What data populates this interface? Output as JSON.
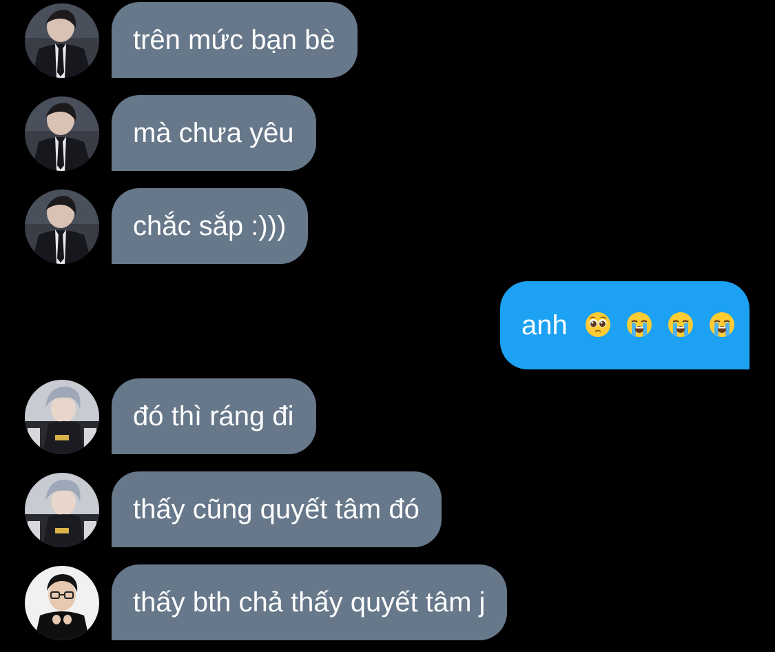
{
  "conversation": {
    "messages": [
      {
        "direction": "incoming",
        "sender_avatar": "avatar-suit-boy",
        "text": "trên mức bạn bè"
      },
      {
        "direction": "incoming",
        "sender_avatar": "avatar-suit-boy",
        "text": "mà chưa yêu"
      },
      {
        "direction": "incoming",
        "sender_avatar": "avatar-suit-boy",
        "text": "chắc sắp :)))"
      },
      {
        "direction": "outgoing",
        "text": "anh",
        "emojis": [
          "pleading-face-emoji",
          "loudly-crying-face-emoji",
          "loudly-crying-face-emoji",
          "loudly-crying-face-emoji"
        ]
      },
      {
        "direction": "incoming",
        "sender_avatar": "avatar-silver-hair",
        "text": "đó thì ráng đi"
      },
      {
        "direction": "incoming",
        "sender_avatar": "avatar-silver-hair",
        "text": "thấy cũng quyết tâm đó"
      },
      {
        "direction": "incoming",
        "sender_avatar": "avatar-glasses-boy",
        "text": "thấy bth chả thấy quyết tâm j"
      }
    ]
  },
  "colors": {
    "background": "#000000",
    "incoming_bubble": "#66788a",
    "outgoing_bubble": "#1da1f2",
    "text": "#ffffff"
  }
}
